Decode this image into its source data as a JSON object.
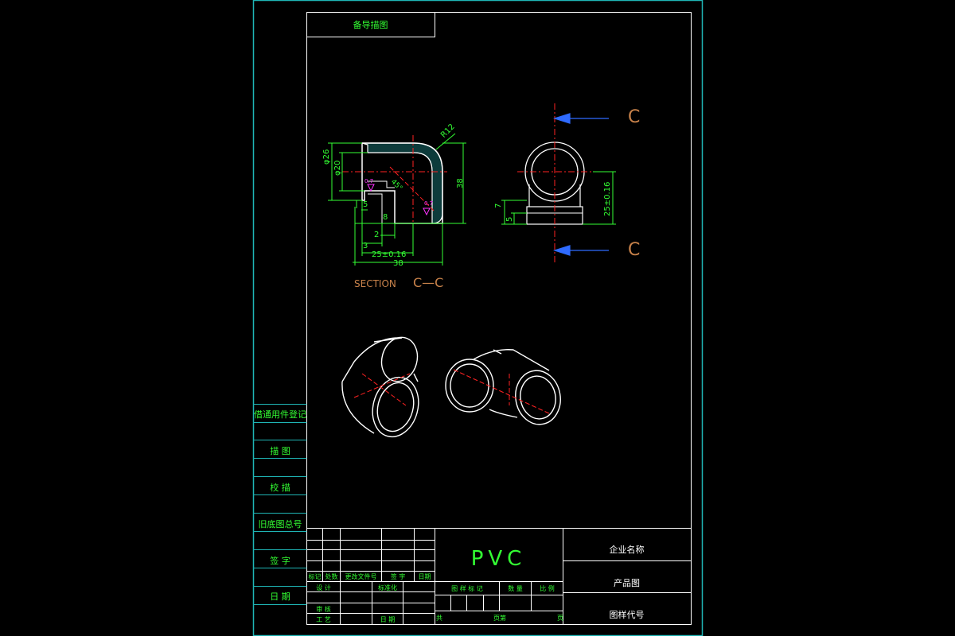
{
  "colors": {
    "frame": "#1fb5b5",
    "line": "#ffffff",
    "green": "#33ff33",
    "cyan": "#00e5e5",
    "red": "#ff2222",
    "blue": "#2f6bff",
    "orange": "#c8824a",
    "magenta": "#ff33ff"
  },
  "top_label": "备导描图",
  "left_column": [
    "借通用件登记",
    "描 图",
    "校 描",
    "旧底图总号",
    "签 字",
    "日 期"
  ],
  "material": "PVC",
  "company_name": "企业名称",
  "product_drawing": "产品图",
  "drawing_code": "图样代号",
  "revision_table": {
    "headers": [
      "标记",
      "处数",
      "更改文件号",
      "签 字",
      "日期"
    ],
    "design": "设 计",
    "standardization": "标准化",
    "review": "审 核",
    "process": "工 艺",
    "date": "日 期"
  },
  "stage_table": {
    "headers": [
      "图 样 标 记",
      "数 量",
      "比 例"
    ],
    "sheet_prefix": "共",
    "sheet_mid": "页第",
    "sheet_suffix": "页"
  },
  "section_view": {
    "caption_word": "SECTION",
    "caption_letters": "C—C",
    "dims": {
      "phi26": "φ26",
      "phi20": "φ20",
      "r12": "R12",
      "d38v": "38",
      "d5": "5",
      "d8": "8",
      "d2": "2",
      "d3": "3",
      "d25": "25±0.16",
      "d38h": "38",
      "d45": "45°",
      "d07": "0.7"
    }
  },
  "side_view": {
    "section_mark": "C",
    "dims": {
      "d7": "7",
      "d5": "5",
      "d25": "25±0.16"
    }
  }
}
